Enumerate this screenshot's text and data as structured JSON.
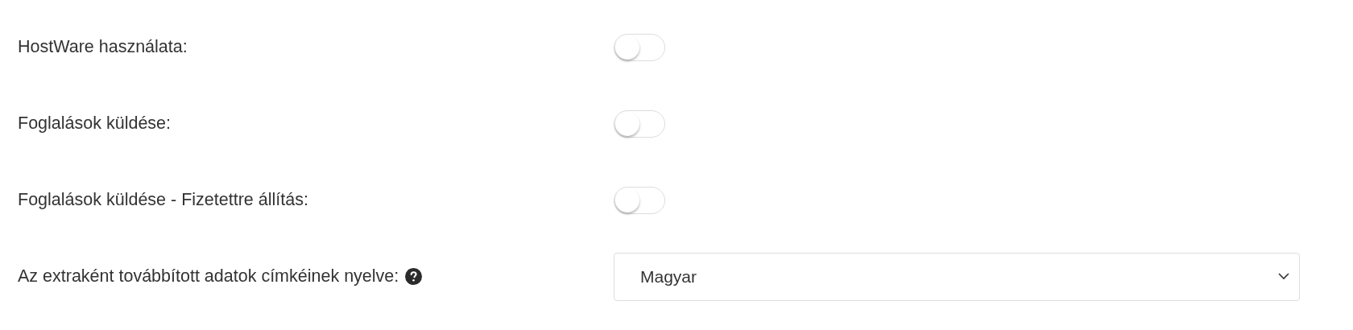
{
  "settings": [
    {
      "kind": "toggle",
      "label": "HostWare használata:",
      "on": false
    },
    {
      "kind": "toggle",
      "label": "Foglalások küldése:",
      "on": false
    },
    {
      "kind": "toggle",
      "label": "Foglalások küldése - Fizetettre állítás:",
      "on": false
    },
    {
      "kind": "select",
      "label": "Az extraként továbbított adatok címkéinek nyelve:",
      "help": true,
      "value": "Magyar"
    }
  ]
}
